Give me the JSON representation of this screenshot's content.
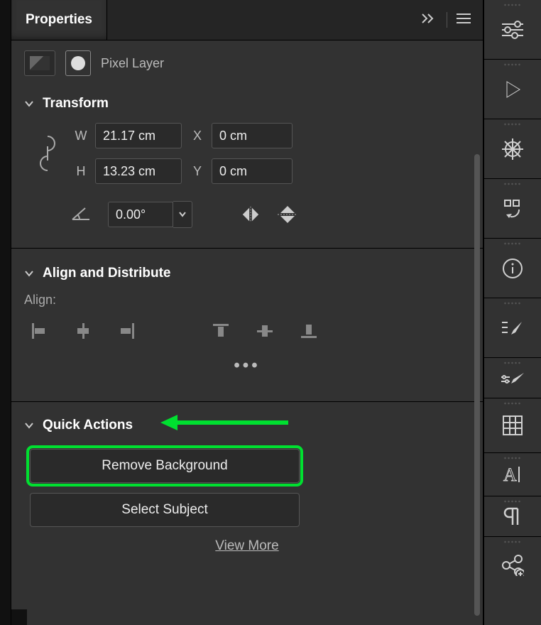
{
  "panel": {
    "title": "Properties",
    "layer_type_label": "Pixel Layer"
  },
  "transform": {
    "title": "Transform",
    "w_label": "W",
    "h_label": "H",
    "x_label": "X",
    "y_label": "Y",
    "w_value": "21.17 cm",
    "h_value": "13.23 cm",
    "x_value": "0 cm",
    "y_value": "0 cm",
    "angle_value": "0.00°"
  },
  "align": {
    "title": "Align and Distribute",
    "label": "Align:"
  },
  "quick_actions": {
    "title": "Quick Actions",
    "remove_background": "Remove Background",
    "select_subject": "Select Subject",
    "view_more": "View More"
  },
  "annotation": {
    "highlight_target": "remove-background-button",
    "arrow_color": "#00e030"
  }
}
